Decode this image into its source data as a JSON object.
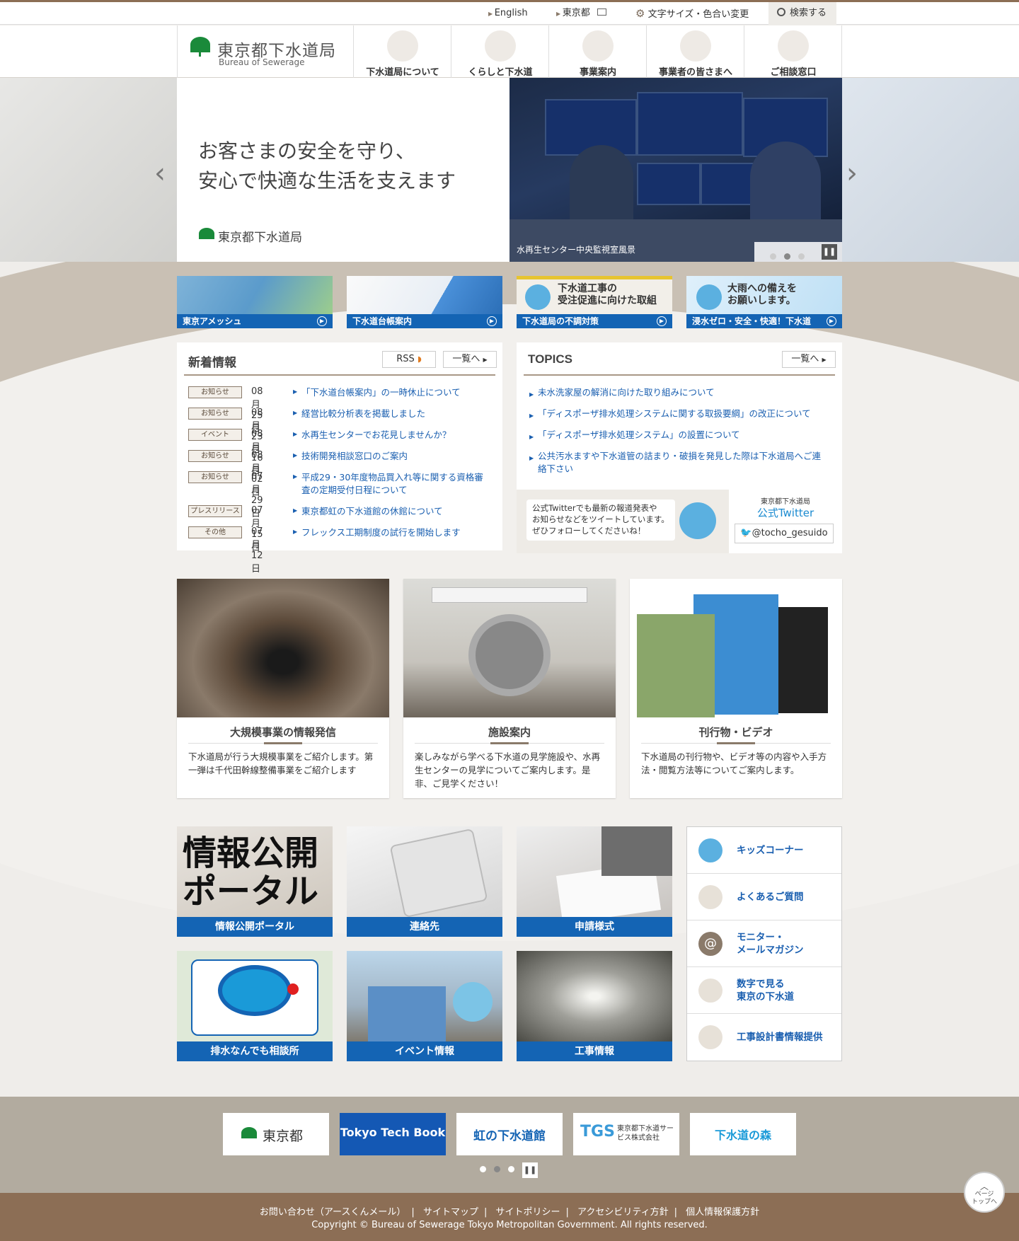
{
  "util": {
    "english": "English",
    "tokyo": "東京都",
    "fontsize": "文字サイズ・色合い変更",
    "search": "検索する"
  },
  "header": {
    "logo_title": "東京都下水道局",
    "logo_sub": "Bureau of Sewerage",
    "nav": [
      "下水道局について",
      "くらしと下水道",
      "事業案内",
      "事業者の皆さまへ",
      "ご相談窓口"
    ]
  },
  "hero": {
    "line1": "お客さまの安全を守り、",
    "line2": "安心で快適な生活を支えます",
    "org": "東京都下水道局",
    "caption": "水再生センター中央監視室風景"
  },
  "banners": [
    {
      "label": "東京アメッシュ",
      "text": ""
    },
    {
      "label": "下水道台帳案内",
      "text": ""
    },
    {
      "label": "下水道局の不調対策",
      "text": "下水道工事の\n受注促進に向けた取組"
    },
    {
      "label": "浸水ゼロ・安全・快適！下水道",
      "text": "大雨への備えを\nお願いします。"
    }
  ],
  "news": {
    "title": "新着情報",
    "rss": "RSS",
    "list": "一覧へ",
    "items": [
      {
        "tag": "お知らせ",
        "date": "08月25日",
        "text": "「下水道台帳案内」の一時休止について"
      },
      {
        "tag": "お知らせ",
        "date": "08月23日",
        "text": "経営比較分析表を掲載しました"
      },
      {
        "tag": "イベント",
        "date": "08月16日",
        "text": "水再生センターでお花見しませんか？"
      },
      {
        "tag": "お知らせ",
        "date": "08月02日",
        "text": "技術開発相談窓口のご案内"
      },
      {
        "tag": "お知らせ",
        "date": "07月29日",
        "text": "平成29・30年度物品買入れ等に関する資格審査の定期受付日程について"
      },
      {
        "tag": "プレスリリース",
        "date": "07月15日",
        "text": "東京都虹の下水道館の休館について"
      },
      {
        "tag": "その他",
        "date": "07月12日",
        "text": "フレックス工期制度の試行を開始します"
      }
    ]
  },
  "topics": {
    "title": "TOPICS",
    "list": "一覧へ",
    "items": [
      "未水洗家屋の解消に向けた取り組みについて",
      "「ディスポーザ排水処理システムに関する取扱要綱」の改正について",
      "「ディスポーザ排水処理システム」の設置について",
      "公共汚水ますや下水道管の詰まり・破損を発見した際は下水道局へご連絡下さい"
    ],
    "twitter_text": "公式Twitterでも最新の報道発表や\nお知らせなどをツイートしています。\nぜひフォローしてくださいね！",
    "twitter_org": "東京都下水道局",
    "twitter_title": "公式Twitter",
    "twitter_handle": "@tocho_gesuido"
  },
  "features": [
    {
      "title": "大規模事業の情報発信",
      "text": "下水道局が行う大規模事業をご紹介します。第一弾は千代田幹線整備事業をご紹介します"
    },
    {
      "title": "施設案内",
      "text": "楽しみながら学べる下水道の見学施設や、水再生センターの見学についてご案内します。是非、ご見学ください！"
    },
    {
      "title": "刊行物・ビデオ",
      "text": "下水道局の刊行物や、ビデオ等の内容や入手方法・閲覧方法等についてご案内します。"
    }
  ],
  "tiles": [
    "情報公開ポータル",
    "連絡先",
    "申請様式",
    "排水なんでも相談所",
    "イベント情報",
    "工事情報"
  ],
  "tile_art": {
    "portal1": "情報公開",
    "portal2": "ポータル"
  },
  "sidelinks": [
    "キッズコーナー",
    "よくあるご質問",
    "モニター・\nメールマガジン",
    "数字で見る\n東京の下水道",
    "工事設計書情報提供"
  ],
  "footer_logos": [
    "東京都",
    "Tokyo Tech Book",
    "虹の下水道館",
    "東京都下水道サービス株式会社",
    "下水道の森"
  ],
  "footer_links": [
    "お問い合わせ（アースくんメール）",
    "サイトマップ",
    "サイトポリシー",
    "アクセシビリティ方針",
    "個人情報保護方針"
  ],
  "copyright": "Copyright © Bureau of Sewerage Tokyo Metropolitan Government. All rights reserved.",
  "pagetop": "ページ\nトップへ"
}
